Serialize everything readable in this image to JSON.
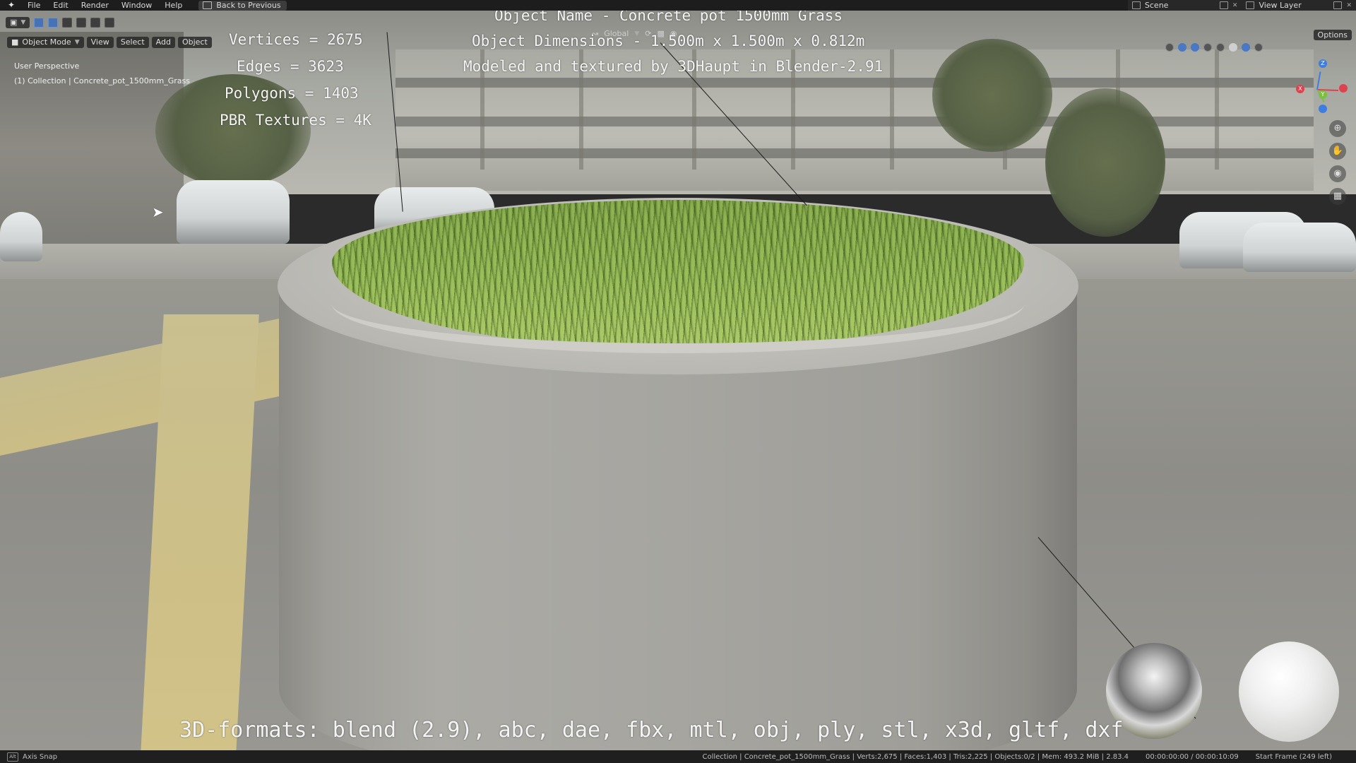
{
  "menu": {
    "items": [
      "File",
      "Edit",
      "Render",
      "Window",
      "Help"
    ],
    "back_button": "Back to Previous"
  },
  "top_right": {
    "scene": "Scene",
    "view_layer": "View Layer"
  },
  "header": {
    "mode": "Object Mode",
    "view": "View",
    "select": "Select",
    "add": "Add",
    "object": "Object",
    "transform_orientation": "Global",
    "options": "Options"
  },
  "viewport_info": {
    "perspective": "User Perspective",
    "collection": "(1) Collection | Concrete_pot_1500mm_Grass"
  },
  "overlay": {
    "object_name": "Object Name - Concrete pot 1500mm Grass",
    "dimensions": "Object Dimensions -  1.500m x 1.500m x 0.812m",
    "credit": "Modeled and textured by 3DHaupt in Blender-2.91",
    "vertices": "Vertices = 2675",
    "edges": "Edges = 3623",
    "polygons": "Polygons = 1403",
    "textures": "PBR Textures = 4K",
    "formats": "3D-formats: blend (2.9), abc, dae, fbx, mtl, obj, ply, stl, x3d, gltf, dxf"
  },
  "gizmo": {
    "x": "X",
    "y": "Y",
    "z": "Z",
    "colors": {
      "x": "#e0414e",
      "y": "#7bc03e",
      "z": "#3d7ee0"
    }
  },
  "statusbar": {
    "key": "Alt",
    "hint": "Axis Snap",
    "stats": "Collection | Concrete_pot_1500mm_Grass | Verts:2,675 | Faces:1,403 | Tris:2,225 | Objects:0/2 | Mem: 493.2 MiB | 2.83.4",
    "time": "00:00:00:00 / 00:00:10:09",
    "frame": "Start Frame (249 left)"
  },
  "colors": {
    "accent": "#4772b3",
    "menubar": "#1d1d1d",
    "grass": "#8fb456",
    "concrete": "#a6a5a0"
  }
}
